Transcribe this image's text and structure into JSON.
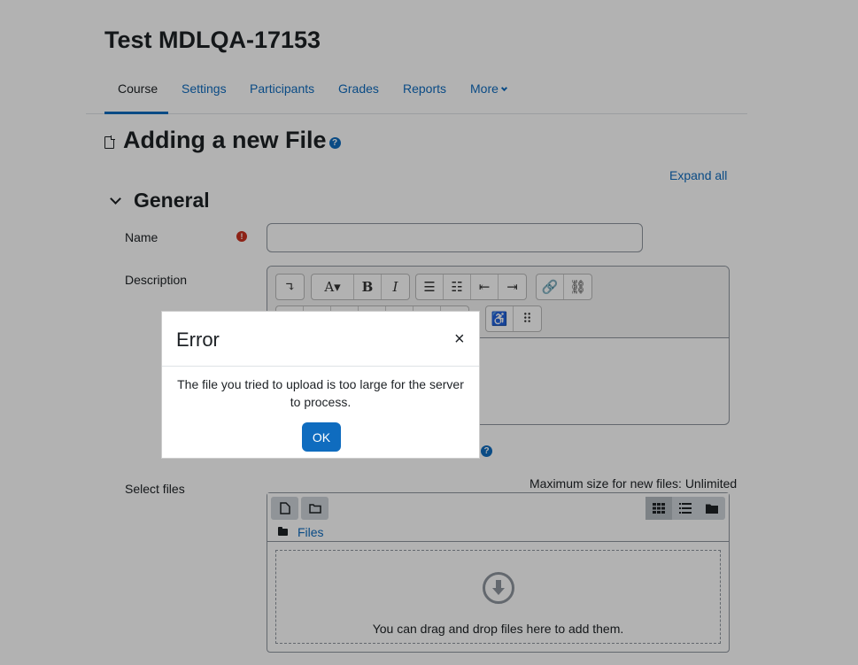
{
  "course": {
    "title": "Test MDLQA-17153"
  },
  "nav": {
    "tabs": [
      {
        "label": "Course"
      },
      {
        "label": "Settings"
      },
      {
        "label": "Participants"
      },
      {
        "label": "Grades"
      },
      {
        "label": "Reports"
      },
      {
        "label": "More"
      }
    ]
  },
  "page": {
    "heading": "Adding a new File",
    "expand_all": "Expand all"
  },
  "form": {
    "section_title": "General",
    "name_label": "Name",
    "name_value": "",
    "description_label": "Description",
    "select_files_label": "Select files",
    "max_size": "Maximum size for new files: Unlimited",
    "files_path": "Files",
    "dropzone_text": "You can drag and drop files here to add them."
  },
  "modal": {
    "title": "Error",
    "close": "×",
    "message": "The file you tried to upload is too large for the server to process.",
    "ok": "OK"
  },
  "colors": {
    "accent": "#0f6cbf",
    "required": "#ca3120",
    "backdrop": "rgba(0,0,0,0.3)"
  }
}
